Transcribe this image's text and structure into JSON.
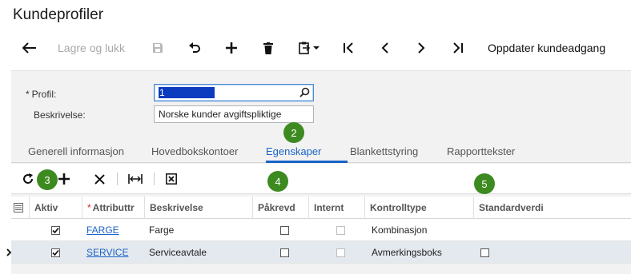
{
  "page": {
    "title": "Kundeprofiler"
  },
  "toolbar": {
    "back_icon": "arrow-left-icon",
    "save_close_label": "Lagre og lukk",
    "save_icon": "floppy-disk-icon",
    "undo_icon": "undo-icon",
    "add_icon": "plus-icon",
    "delete_icon": "trash-icon",
    "paste_icon": "clipboard-icon",
    "first_icon": "first-record-icon",
    "prev_icon": "chevron-left-icon",
    "next_icon": "chevron-right-icon",
    "last_icon": "last-record-icon",
    "update_access_label": "Oppdater kundeadgang"
  },
  "form": {
    "profile_label": "Profil:",
    "required_marker": "*",
    "profile_value": "1",
    "description_label": "Beskrivelse:",
    "description_value": "Norske kunder avgiftspliktige"
  },
  "badges": [
    "2",
    "3",
    "4",
    "5"
  ],
  "tabs": [
    {
      "label": "Generell informasjon",
      "active": false
    },
    {
      "label": "Hovedbokskontoer",
      "active": false
    },
    {
      "label": "Egenskaper",
      "active": true
    },
    {
      "label": "Blankettstyring",
      "active": false
    },
    {
      "label": "Rapporttekster",
      "active": false
    }
  ],
  "grid_toolbar": {
    "refresh_icon": "refresh-icon",
    "add_icon": "plus-icon",
    "delete_icon": "close-icon",
    "fit_icon": "fit-width-icon",
    "export_icon": "excel-export-icon"
  },
  "grid": {
    "columns": {
      "active": "Aktiv",
      "attribute": "Attributtr",
      "description": "Beskrivelse",
      "required": "Påkrevd",
      "internal": "Internt",
      "control_type": "Kontrolltype",
      "default_value": "Standardverdi"
    },
    "required_marker": "*",
    "rows": [
      {
        "active": true,
        "attribute": "FARGE",
        "description": "Farge",
        "required": false,
        "internal": false,
        "control_type": "Kombinasjon",
        "default_value": "",
        "selected": false
      },
      {
        "active": true,
        "attribute": "SERVICE",
        "description": "Serviceavtale",
        "required": false,
        "internal": false,
        "control_type": "Avmerkingsboks",
        "default_value": "checkbox",
        "selected": true
      }
    ]
  }
}
